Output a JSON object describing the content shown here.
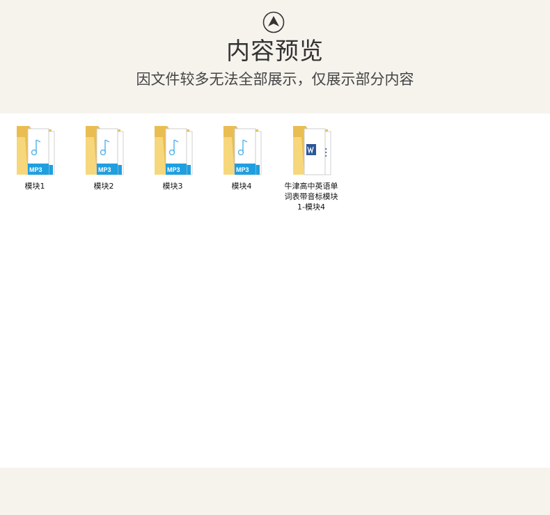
{
  "header": {
    "icon": "arrow-up-circle-icon",
    "title": "内容预览",
    "subtitle": "因文件较多无法全部展示，仅展示部分内容"
  },
  "files": [
    {
      "name": "模块1",
      "type": "mp3-folder",
      "icon": "mp3-folder-icon"
    },
    {
      "name": "模块2",
      "type": "mp3-folder",
      "icon": "mp3-folder-icon"
    },
    {
      "name": "模块3",
      "type": "mp3-folder",
      "icon": "mp3-folder-icon"
    },
    {
      "name": "模块4",
      "type": "mp3-folder",
      "icon": "mp3-folder-icon"
    },
    {
      "name": "牛津高中英语单词表带音标模块1-模块4",
      "type": "word-folder",
      "icon": "word-folder-icon"
    }
  ],
  "colors": {
    "background": "#f6f3ed",
    "folder": "#f7d77c",
    "folder_dark": "#e9bd52",
    "mp3_blue": "#1f9fe0",
    "word_blue": "#2b579a"
  }
}
